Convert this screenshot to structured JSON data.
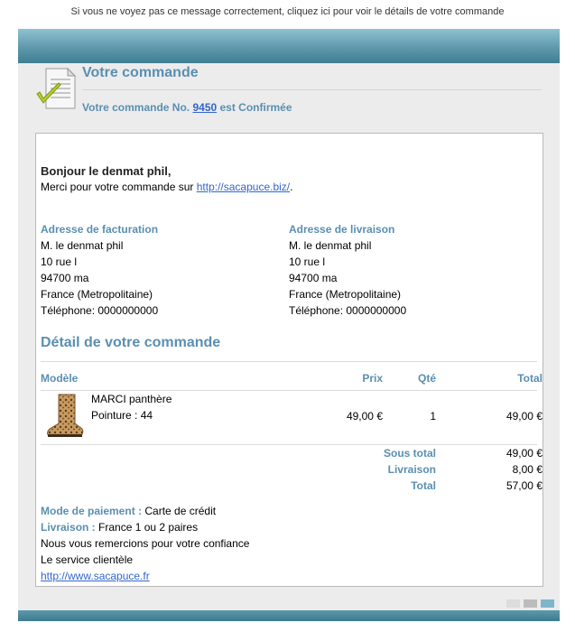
{
  "top_note": "Si vous ne voyez pas ce message correctement, cliquez ici pour voir le détails de votre commande",
  "header": {
    "title": "Votre commande",
    "confirm_prefix": "Votre commande No. ",
    "order_number": "9450",
    "confirm_suffix": " est Confirmée"
  },
  "greeting": "Bonjour le denmat phil,",
  "thanks": {
    "prefix": "Merci pour votre commande sur ",
    "link": "http://sacapuce.biz/",
    "suffix": "."
  },
  "billing": {
    "label": "Adresse de facturation",
    "name": "M. le denmat phil",
    "street": "10 rue l",
    "city": "94700 ma",
    "country": "France (Metropolitaine)",
    "phone": "Téléphone: 0000000000"
  },
  "shipping": {
    "label": "Adresse de livraison",
    "name": "M. le denmat phil",
    "street": "10 rue l",
    "city": "94700 ma",
    "country": "France (Metropolitaine)",
    "phone": "Téléphone: 0000000000"
  },
  "detail_title": "Détail de votre commande",
  "table": {
    "headers": {
      "model": "Modèle",
      "price": "Prix",
      "qty": "Qté",
      "total": "Total"
    },
    "items": [
      {
        "name": "MARCI panthère",
        "size": "Pointure : 44",
        "price": "49,00 €",
        "qty": "1",
        "total": "49,00 €",
        "image": "leopard-boot-image"
      }
    ]
  },
  "totals": {
    "subtotal_label": "Sous total",
    "subtotal": "49,00 €",
    "shipping_label": "Livraison",
    "shipping": "8,00 €",
    "total_label": "Total",
    "total": "57,00 €"
  },
  "payment": {
    "label": "Mode de paiement : ",
    "value": "Carte de crédit"
  },
  "delivery": {
    "label": "Livraison : ",
    "value": "France 1 ou 2 paires"
  },
  "closing1": "Nous vous remercions pour votre confiance",
  "closing2": "Le service clientèle",
  "footer_link": "http://www.sacapuce.fr",
  "colors": {
    "accent": "#5a8fb1",
    "link": "#3366cc",
    "banner": "#5e98ab",
    "card": "#ececec"
  }
}
